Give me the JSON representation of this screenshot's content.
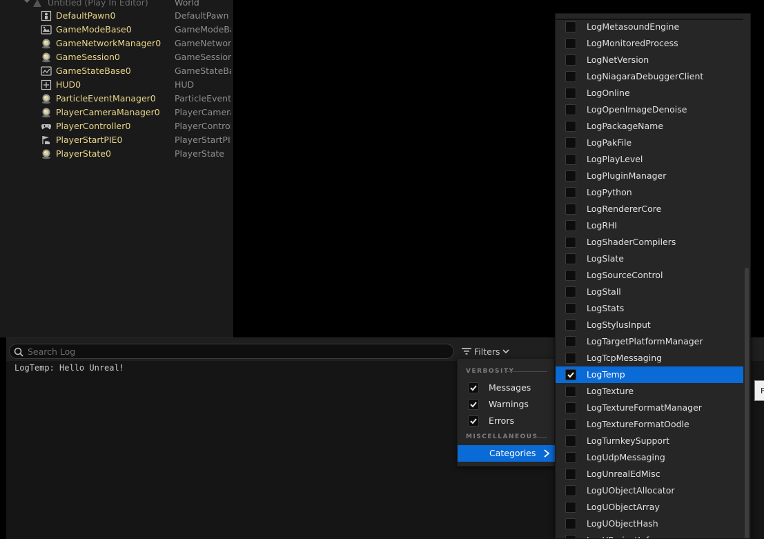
{
  "outliner": {
    "world_row": {
      "name": "Untitled (Play In Editor)",
      "type": "World"
    },
    "items": [
      {
        "name": "DefaultPawn0",
        "type": "DefaultPawn",
        "icon": "pawn-icon"
      },
      {
        "name": "GameModeBase0",
        "type": "GameModeBa",
        "icon": "gamemode-icon"
      },
      {
        "name": "GameNetworkManager0",
        "type": "GameNetwork",
        "icon": "actor-sphere-icon"
      },
      {
        "name": "GameSession0",
        "type": "GameSession",
        "icon": "actor-sphere-icon"
      },
      {
        "name": "GameStateBase0",
        "type": "GameStateBa",
        "icon": "gamestate-icon"
      },
      {
        "name": "HUD0",
        "type": "HUD",
        "icon": "hud-icon"
      },
      {
        "name": "ParticleEventManager0",
        "type": "ParticleEventM",
        "icon": "actor-sphere-icon"
      },
      {
        "name": "PlayerCameraManager0",
        "type": "PlayerCamera",
        "icon": "actor-sphere-icon"
      },
      {
        "name": "PlayerController0",
        "type": "PlayerControll",
        "icon": "gamepad-icon"
      },
      {
        "name": "PlayerStartPIE0",
        "type": "PlayerStartPIE",
        "icon": "player-start-icon"
      },
      {
        "name": "PlayerState0",
        "type": "PlayerState",
        "icon": "actor-sphere-icon"
      }
    ]
  },
  "output_log": {
    "search_placeholder": "Search Log",
    "filters_label": "Filters",
    "log_line": "LogTemp: Hello Unreal!"
  },
  "filters_menu": {
    "verbosity_header": "VERBOSITY",
    "misc_header": "MISCELLANEOUS",
    "verbosity": [
      {
        "label": "Messages",
        "checked": true
      },
      {
        "label": "Warnings",
        "checked": true
      },
      {
        "label": "Errors",
        "checked": true
      }
    ],
    "categories_label": "Categories"
  },
  "categories_menu": {
    "items": [
      {
        "label": "LogMetasoundEngine",
        "checked": false
      },
      {
        "label": "LogMonitoredProcess",
        "checked": false
      },
      {
        "label": "LogNetVersion",
        "checked": false
      },
      {
        "label": "LogNiagaraDebuggerClient",
        "checked": false
      },
      {
        "label": "LogOnline",
        "checked": false
      },
      {
        "label": "LogOpenImageDenoise",
        "checked": false
      },
      {
        "label": "LogPackageName",
        "checked": false
      },
      {
        "label": "LogPakFile",
        "checked": false
      },
      {
        "label": "LogPlayLevel",
        "checked": false
      },
      {
        "label": "LogPluginManager",
        "checked": false
      },
      {
        "label": "LogPython",
        "checked": false
      },
      {
        "label": "LogRendererCore",
        "checked": false
      },
      {
        "label": "LogRHI",
        "checked": false
      },
      {
        "label": "LogShaderCompilers",
        "checked": false
      },
      {
        "label": "LogSlate",
        "checked": false
      },
      {
        "label": "LogSourceControl",
        "checked": false
      },
      {
        "label": "LogStall",
        "checked": false
      },
      {
        "label": "LogStats",
        "checked": false
      },
      {
        "label": "LogStylusInput",
        "checked": false
      },
      {
        "label": "LogTargetPlatformManager",
        "checked": false
      },
      {
        "label": "LogTcpMessaging",
        "checked": false
      },
      {
        "label": "LogTemp",
        "checked": true
      },
      {
        "label": "LogTexture",
        "checked": false
      },
      {
        "label": "LogTextureFormatManager",
        "checked": false
      },
      {
        "label": "LogTextureFormatOodle",
        "checked": false
      },
      {
        "label": "LogTurnkeySupport",
        "checked": false
      },
      {
        "label": "LogUdpMessaging",
        "checked": false
      },
      {
        "label": "LogUnrealEdMisc",
        "checked": false
      },
      {
        "label": "LogUObjectAllocator",
        "checked": false
      },
      {
        "label": "LogUObjectArray",
        "checked": false
      },
      {
        "label": "LogUObjectHash",
        "checked": false
      },
      {
        "label": "LogUProjectInfo",
        "checked": false
      }
    ]
  },
  "tooltip_stub": {
    "text": "F"
  },
  "colors": {
    "accent": "#0a6ad6",
    "actor_name": "#e8d58a",
    "panel_bg": "#262626"
  }
}
